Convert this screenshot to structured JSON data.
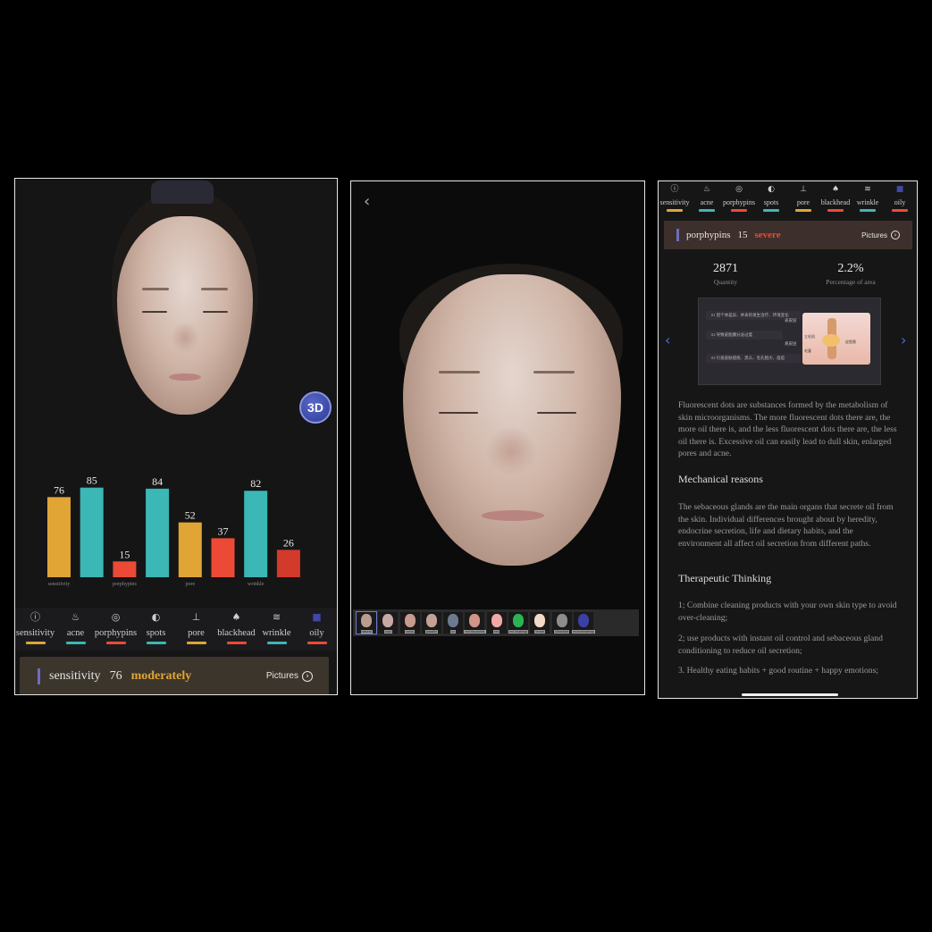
{
  "colors": {
    "yellow": "#e0a535",
    "teal": "#3bb7b6",
    "red": "#ec4a36",
    "indigo": "#3f48a8"
  },
  "screen1": {
    "badge_3d": "3D",
    "tabs": [
      {
        "label": "sensitivity",
        "icon": "alert-circle-icon",
        "glyph": "ⓘ",
        "color": "#e0a535"
      },
      {
        "label": "acne",
        "icon": "acne-icon",
        "glyph": "♨",
        "color": "#3bb7b6"
      },
      {
        "label": "porphypins",
        "icon": "porphyrin-icon",
        "glyph": "◎",
        "color": "#ec4a36"
      },
      {
        "label": "spots",
        "icon": "spots-icon",
        "glyph": "◐",
        "color": "#3bb7b6"
      },
      {
        "label": "pore",
        "icon": "pore-icon",
        "glyph": "⊥",
        "color": "#e0a535"
      },
      {
        "label": "blackhead",
        "icon": "blackhead-icon",
        "glyph": "♠",
        "color": "#ec4a36"
      },
      {
        "label": "wrinkle",
        "icon": "wrinkle-icon",
        "glyph": "≋",
        "color": "#3bb7b6"
      },
      {
        "label": "oily",
        "icon": "oily-square-icon",
        "glyph": "■",
        "color": "#ec4a36"
      }
    ],
    "status": {
      "name": "sensitivity",
      "score": "76",
      "level": "moderately",
      "level_color": "#e0a535",
      "pictures": "Pictures",
      "pictures_icon": "›"
    }
  },
  "chart_data": {
    "type": "bar",
    "categories": [
      "sensitivity",
      "acne",
      "porphypins",
      "spots",
      "pore",
      "blackhead",
      "wrinkle",
      "oily"
    ],
    "values": [
      76,
      85,
      15,
      84,
      52,
      37,
      82,
      26
    ],
    "tick_labels": [
      "sensitivity",
      "",
      "porphypins",
      "",
      "pore",
      "",
      "wrinkle",
      ""
    ],
    "colors": [
      "#e0a535",
      "#3bb7b6",
      "#ec4a36",
      "#3bb7b6",
      "#e0a535",
      "#ec4a36",
      "#3bb7b6",
      "#d23a2c"
    ],
    "ylim": [
      0,
      100
    ],
    "grid": false,
    "legend": "none"
  },
  "screen2": {
    "back_icon": "‹",
    "thumbnails": [
      {
        "label": "natural",
        "tint": "#b99b90"
      },
      {
        "label": "cool",
        "tint": "#c7a9a5"
      },
      {
        "label": "cross",
        "tint": "#c69b90"
      },
      {
        "label": "parallel",
        "tint": "#c4a196"
      },
      {
        "label": "uv",
        "tint": "#6c7a90"
      },
      {
        "label": "red bloodcells",
        "tint": "#d19588"
      },
      {
        "label": "red",
        "tint": "#f2a7a7"
      },
      {
        "label": "red heatmap",
        "tint": "#2bb354"
      },
      {
        "label": "brown",
        "tint": "#f4d9c6"
      },
      {
        "label": "ultraviolet",
        "tint": "#8c8c8c"
      },
      {
        "label": "brownheatmap",
        "tint": "#3d3fa8"
      }
    ]
  },
  "screen3": {
    "tabs": [
      {
        "label": "sensitivity",
        "icon": "alert-circle-icon",
        "glyph": "ⓘ",
        "color": "#e0a535"
      },
      {
        "label": "acne",
        "icon": "acne-icon",
        "glyph": "♨",
        "color": "#3bb7b6"
      },
      {
        "label": "porphypins",
        "icon": "porphyrin-icon",
        "glyph": "◎",
        "color": "#ec4a36"
      },
      {
        "label": "spots",
        "icon": "spots-icon",
        "glyph": "◐",
        "color": "#3bb7b6"
      },
      {
        "label": "pore",
        "icon": "pore-icon",
        "glyph": "⊥",
        "color": "#e0a535"
      },
      {
        "label": "blackhead",
        "icon": "blackhead-icon",
        "glyph": "♠",
        "color": "#ec4a36"
      },
      {
        "label": "wrinkle",
        "icon": "wrinkle-icon",
        "glyph": "≋",
        "color": "#3bb7b6"
      },
      {
        "label": "oily",
        "icon": "oily-square-icon",
        "glyph": "■",
        "color": "#ec4a36"
      }
    ],
    "status": {
      "name": "porphypins",
      "score": "15",
      "level": "severe",
      "level_color": "#ec4a36",
      "pictures": "Pictures",
      "pictures_icon": "›"
    },
    "metrics": [
      {
        "value": "2871",
        "label": "Quantity"
      },
      {
        "value": "2.2%",
        "label": "Percentage of area"
      }
    ],
    "diagram": {
      "rows": [
        "01 因个体差异、并表的发生治疗、环境变化",
        "02 导致皮脂腺分泌过度",
        "03 引发皮肤痤疮、黑头、毛孔粗大、痘痘"
      ],
      "labels": [
        "表皮层",
        "真皮层",
        "立毛肌",
        "毛囊",
        "皮脂腺"
      ]
    },
    "paragraph1": "Fluorescent dots are substances formed by the metabolism of skin microorganisms. The more fluorescent dots there are, the more oil there is, and the less fluorescent dots there are, the less oil there is. Excessive oil can easily lead to dull skin, enlarged pores and acne.",
    "heading1": "Mechanical reasons",
    "paragraph2": "The sebaceous glands are the main organs that secrete oil from the skin. Individual differences brought about by heredity, endocrine secretion, life and dietary habits, and the environment all affect oil secretion from different paths.",
    "heading2": "Therapeutic Thinking",
    "tip1": "1; Combine cleaning products with your own skin type to avoid over-cleaning;",
    "tip2": "2; use products with instant oil control and sebaceous gland conditioning to reduce oil secretion;",
    "tip3": "3. Healthy eating habits + good routine + happy emotions;"
  }
}
